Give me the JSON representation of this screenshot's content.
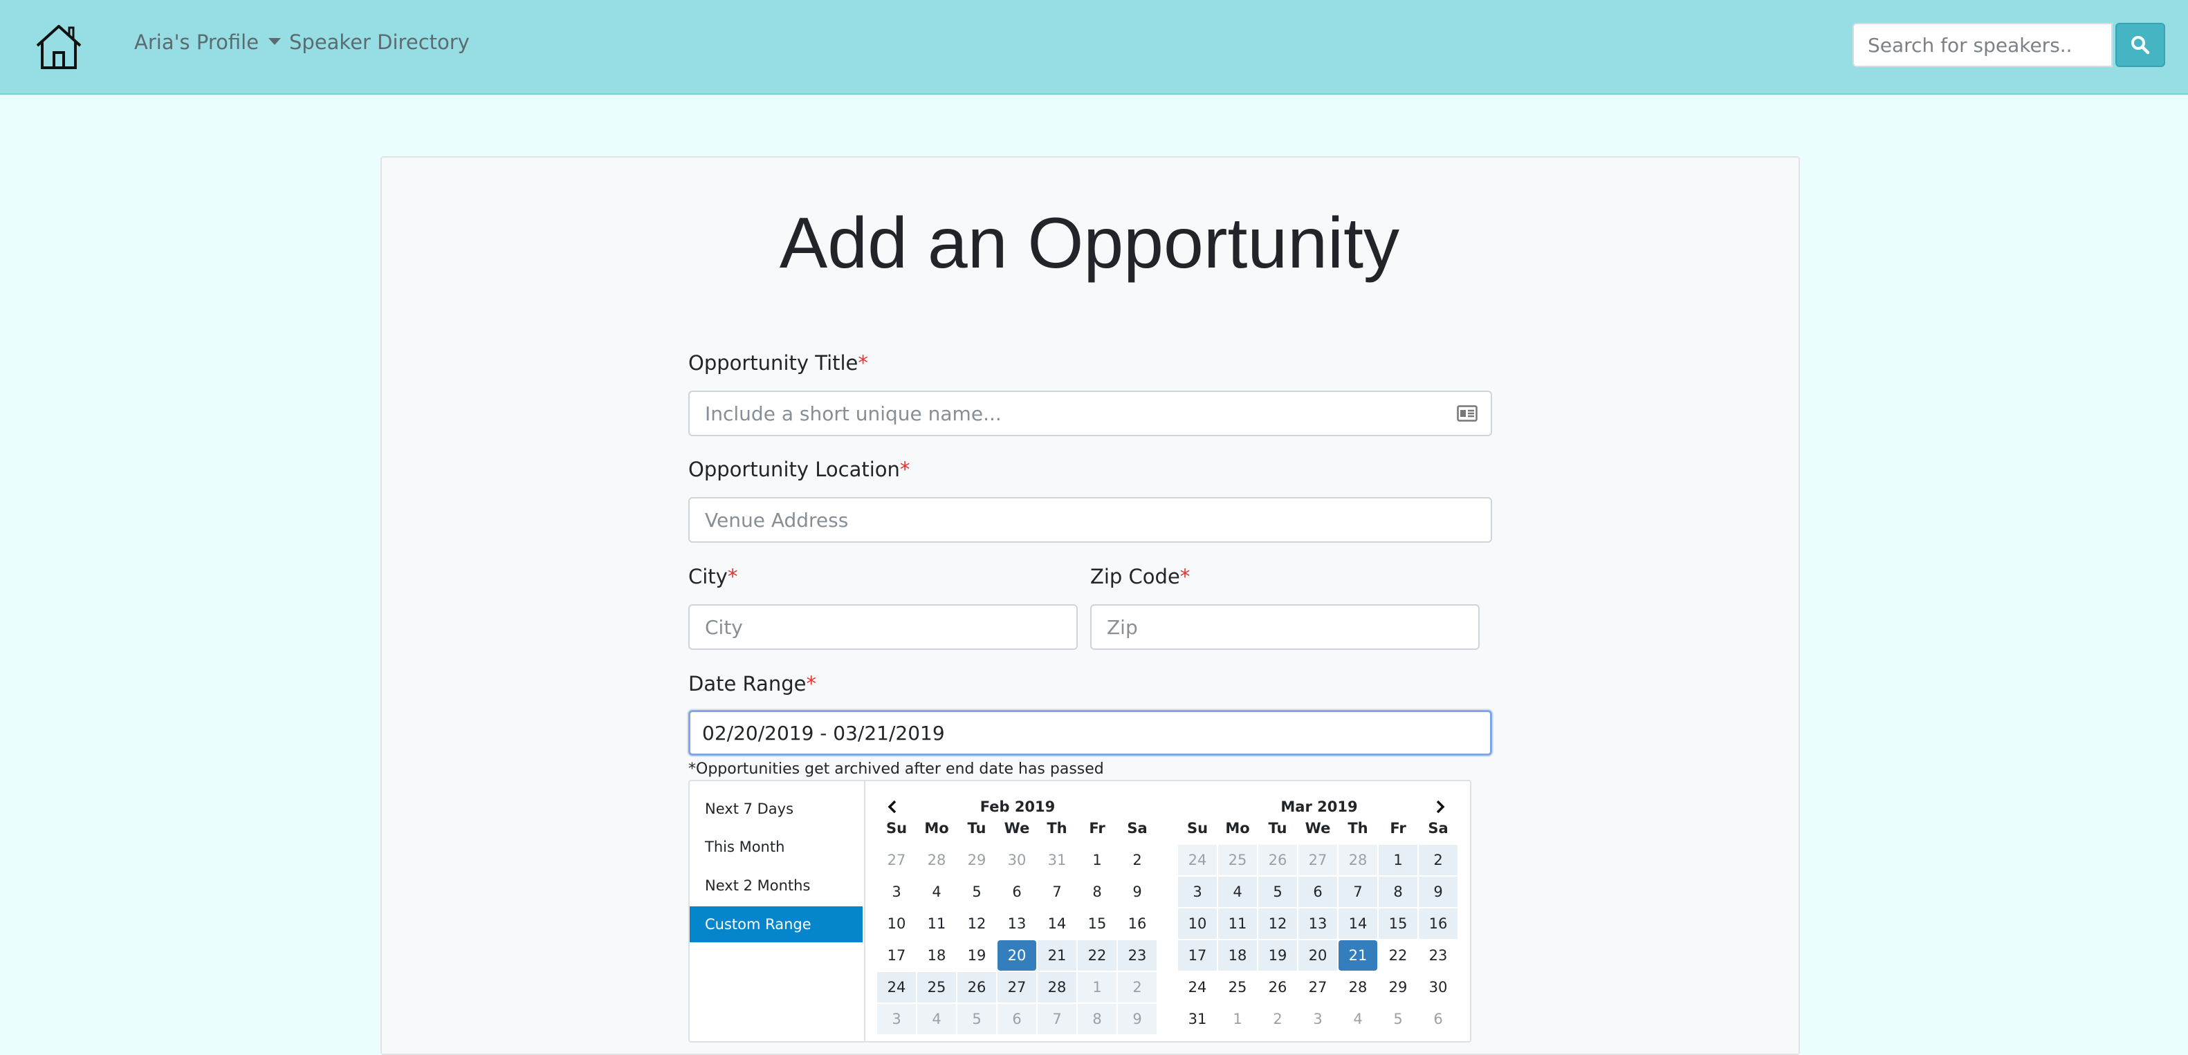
{
  "navbar": {
    "home_icon": "home-icon",
    "profile_label": "Aria's Profile",
    "directory_label": "Speaker Directory",
    "search_placeholder": "Search for speakers..",
    "search_icon": "search-icon",
    "colors": {
      "bar": "#96dee4",
      "search_button": "#45b5c4"
    }
  },
  "form": {
    "title": "Add an Opportunity",
    "required_mark": "*",
    "opportunity_title": {
      "label": "Opportunity Title",
      "placeholder": "Include a short unique name...",
      "icon": "id-card-icon"
    },
    "location": {
      "label": "Opportunity Location",
      "placeholder": "Venue Address"
    },
    "city": {
      "label": "City",
      "placeholder": "City"
    },
    "zip": {
      "label": "Zip Code",
      "placeholder": "Zip"
    },
    "date_range": {
      "label": "Date Range",
      "value": "02/20/2019 - 03/21/2019"
    },
    "help_text": "*Opportunities get archived after end date has passed"
  },
  "datepicker": {
    "ranges": [
      "Next 7 Days",
      "This Month",
      "Next 2 Months",
      "Custom Range"
    ],
    "active_range": "Custom Range",
    "weekdays": [
      "Su",
      "Mo",
      "Tu",
      "We",
      "Th",
      "Fr",
      "Sa"
    ],
    "left_month": {
      "title": "Feb 2019",
      "rows": [
        [
          "27",
          "28",
          "29",
          "30",
          "31",
          "1",
          "2"
        ],
        [
          "3",
          "4",
          "5",
          "6",
          "7",
          "8",
          "9"
        ],
        [
          "10",
          "11",
          "12",
          "13",
          "14",
          "15",
          "16"
        ],
        [
          "17",
          "18",
          "19",
          "20",
          "21",
          "22",
          "23"
        ],
        [
          "24",
          "25",
          "26",
          "27",
          "28",
          "1",
          "2"
        ],
        [
          "3",
          "4",
          "5",
          "6",
          "7",
          "8",
          "9"
        ]
      ]
    },
    "right_month": {
      "title": "Mar 2019",
      "rows": [
        [
          "24",
          "25",
          "26",
          "27",
          "28",
          "1",
          "2"
        ],
        [
          "3",
          "4",
          "5",
          "6",
          "7",
          "8",
          "9"
        ],
        [
          "10",
          "11",
          "12",
          "13",
          "14",
          "15",
          "16"
        ],
        [
          "17",
          "18",
          "19",
          "20",
          "21",
          "22",
          "23"
        ],
        [
          "24",
          "25",
          "26",
          "27",
          "28",
          "29",
          "30"
        ],
        [
          "31",
          "1",
          "2",
          "3",
          "4",
          "5",
          "6"
        ]
      ]
    },
    "range_start": "02/20/2019",
    "range_end": "03/21/2019",
    "colors": {
      "endpoint": "#357ebd",
      "in_range": "#e7eff6",
      "active_range": "#0586cc"
    }
  }
}
